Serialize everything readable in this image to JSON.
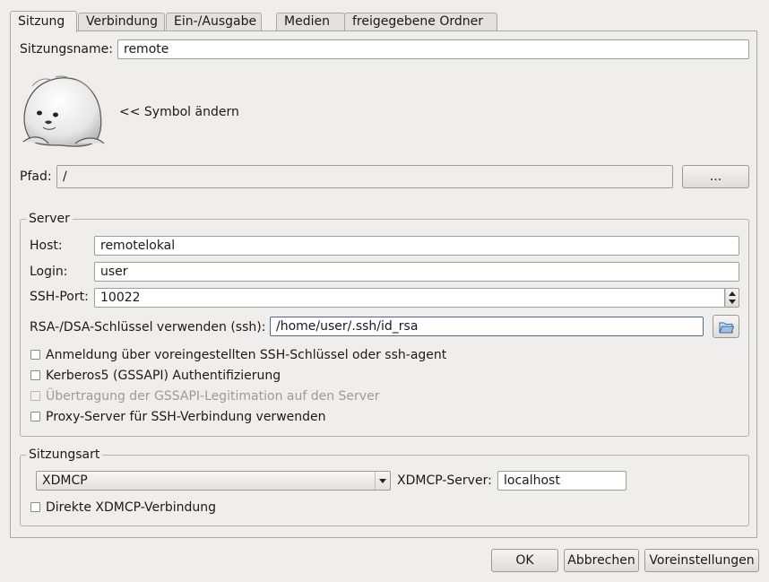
{
  "tabs": [
    {
      "label": "Sitzung",
      "active": true
    },
    {
      "label": "Verbindung",
      "active": false
    },
    {
      "label": "Ein-/Ausgabe",
      "active": false
    },
    {
      "label": "Medien",
      "active": false
    },
    {
      "label": "freigegebene Ordner",
      "active": false
    }
  ],
  "session": {
    "name_label": "Sitzungsname:",
    "name_value": "remote",
    "icon_name": "seal-icon",
    "change_icon_label": "<< Symbol ändern",
    "path_label": "Pfad:",
    "path_value": "/",
    "browse_label": "..."
  },
  "server": {
    "group_title": "Server",
    "host_label": "Host:",
    "host_value": "remotelokal",
    "login_label": "Login:",
    "login_value": "user",
    "port_label": "SSH-Port:",
    "port_value": "10022",
    "key_label": "RSA-/DSA-Schlüssel verwenden (ssh):",
    "key_value": "/home/user/.ssh/id_rsa",
    "checkboxes": [
      {
        "label": "Anmeldung über voreingestellten SSH-Schlüssel oder ssh-agent",
        "checked": false,
        "enabled": true
      },
      {
        "label": "Kerberos5 (GSSAPI) Authentifizierung",
        "checked": false,
        "enabled": true
      },
      {
        "label": "Übertragung der GSSAPI-Legitimation auf den Server",
        "checked": false,
        "enabled": false
      },
      {
        "label": "Proxy-Server für SSH-Verbindung verwenden",
        "checked": false,
        "enabled": true
      }
    ]
  },
  "session_type": {
    "group_title": "Sitzungsart",
    "selected": "XDMCP",
    "xdmcp_server_label": "XDMCP-Server:",
    "xdmcp_server_value": "localhost",
    "direct_label": "Direkte XDMCP-Verbindung",
    "direct_checked": false
  },
  "buttons": {
    "ok": "OK",
    "cancel": "Abbrechen",
    "defaults": "Voreinstellungen"
  },
  "colors": {
    "background": "#efeeec",
    "disabled_text": "#9c9b97"
  }
}
